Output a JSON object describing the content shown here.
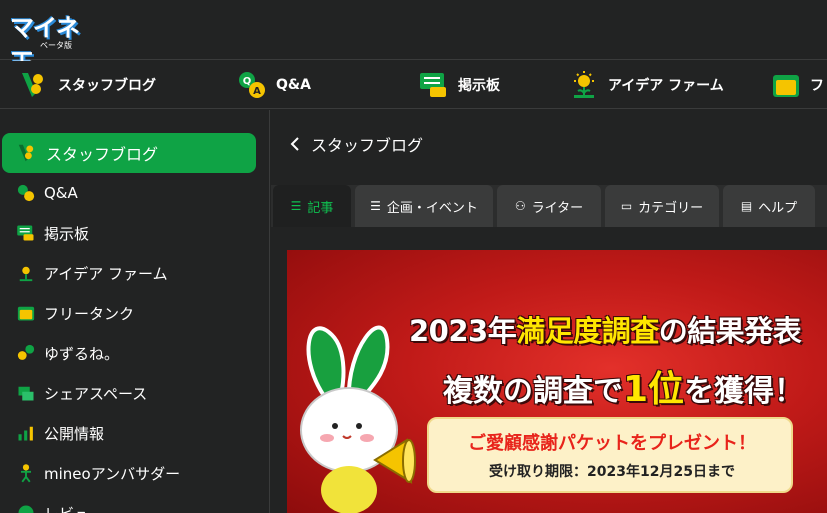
{
  "header": {
    "logo_text": "マイネ王",
    "logo_sub": "ベータ版"
  },
  "topnav": {
    "items": [
      {
        "label": "スタッフブログ",
        "icon": "staff-blog-icon"
      },
      {
        "label": "Q&A",
        "icon": "qa-icon"
      },
      {
        "label": "掲示板",
        "icon": "board-icon"
      },
      {
        "label": "アイデア ファーム",
        "icon": "idea-icon"
      },
      {
        "label": "フ",
        "icon": "tank-icon"
      }
    ]
  },
  "sidebar": {
    "items": [
      {
        "label": "スタッフブログ",
        "icon": "staff-blog-icon",
        "active": true
      },
      {
        "label": "Q&A",
        "icon": "qa-icon"
      },
      {
        "label": "掲示板",
        "icon": "board-icon"
      },
      {
        "label": "アイデア ファーム",
        "icon": "idea-icon"
      },
      {
        "label": "フリータンク",
        "icon": "tank-icon"
      },
      {
        "label": "ゆずるね。",
        "icon": "yuzurune-icon"
      },
      {
        "label": "シェアスペース",
        "icon": "share-space-icon"
      },
      {
        "label": "公開情報",
        "icon": "public-info-icon"
      },
      {
        "label": "mineoアンバサダー",
        "icon": "ambassador-icon"
      },
      {
        "label": "レビュ",
        "icon": "review-icon"
      }
    ]
  },
  "main": {
    "breadcrumb_label": "スタッフブログ",
    "tabs": [
      {
        "label": "記事",
        "icon": "list-icon",
        "active": true
      },
      {
        "label": "企画・イベント",
        "icon": "list-icon"
      },
      {
        "label": "ライター",
        "icon": "writers-icon"
      },
      {
        "label": "カテゴリー",
        "icon": "folder-icon"
      },
      {
        "label": "ヘルプ",
        "icon": "help-icon"
      }
    ],
    "banner": {
      "line1_year": "2023年",
      "line1_highlight": "満足度調査",
      "line1_mid": "の",
      "line1_end": "結果発表",
      "line2_start": "複数の調査で",
      "line2_highlight": "1位",
      "line2_end": "を獲得！",
      "present_title": "ご愛顧感謝パケットをプレゼント！",
      "present_sub": "受け取り期限：2023年12月25日まで"
    }
  },
  "colors": {
    "accent": "#0fa345",
    "background": "#222323",
    "banner_red": "#c01a18",
    "highlight_yellow": "#ffe600"
  }
}
